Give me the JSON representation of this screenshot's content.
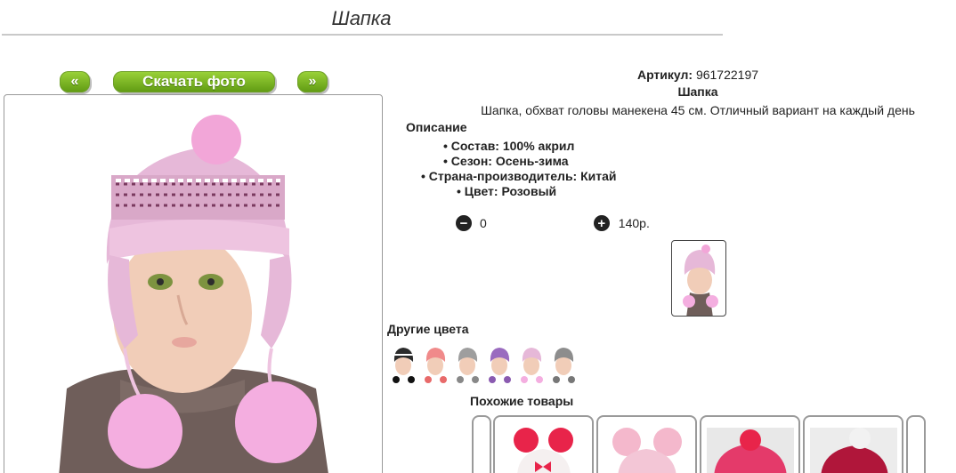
{
  "page": {
    "title": "Шапка"
  },
  "nav": {
    "prev": "«",
    "download": "Скачать фото",
    "next": "»"
  },
  "product": {
    "article_label": "Артикул:",
    "article_value": "961722197",
    "name": "Шапка",
    "description": "Шапка, обхват головы манекена 45 см. Отличный вариант на каждый день",
    "description_heading": "Описание",
    "properties": [
      "Состав: 100% акрил",
      "Сезон: Осень-зима",
      "Страна-производитель: Китай",
      "Цвет: Розовый"
    ],
    "quantity": "0",
    "price": "140р."
  },
  "icons": {
    "minus": "minus-circle-icon",
    "plus": "plus-circle-icon"
  },
  "other_colors": {
    "heading": "Другие цвета",
    "swatches": [
      "black",
      "coral",
      "grey",
      "purple",
      "pink",
      "grey"
    ]
  },
  "similar": {
    "heading": "Похожие товары"
  },
  "colors": {
    "button_green_top": "#9cd33a",
    "button_green_bottom": "#5f9a12",
    "hat_pink": "#e8b6d8"
  }
}
